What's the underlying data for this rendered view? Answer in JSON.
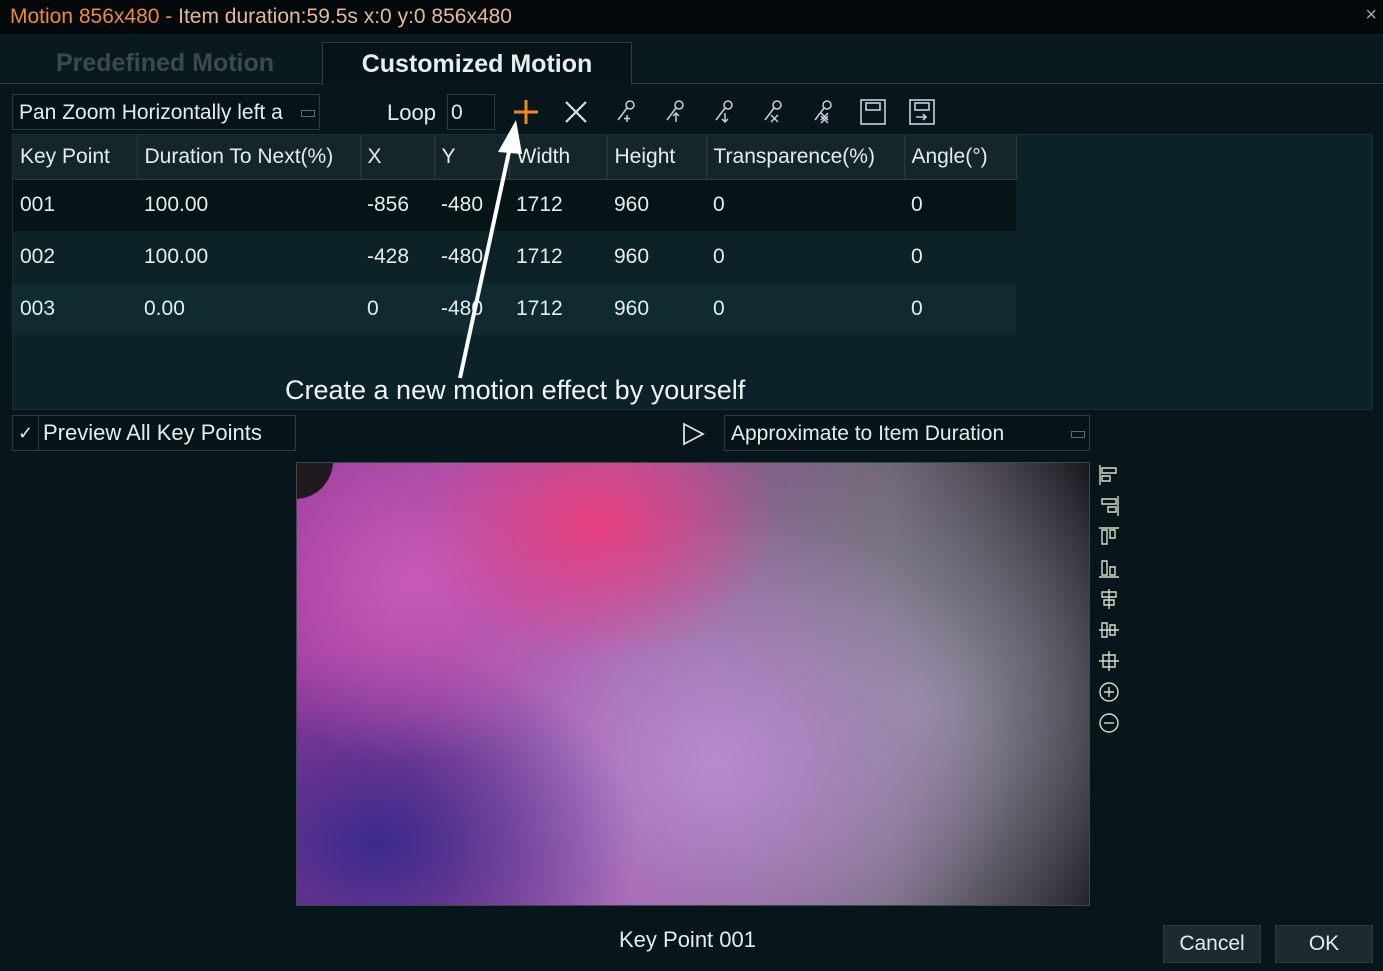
{
  "window": {
    "title_prefix": "Motion 856x480 - ",
    "title_rest": "Item duration:59.5s x:0 y:0 856x480",
    "close": "×"
  },
  "tabs": [
    {
      "label": "Predefined Motion",
      "active": false
    },
    {
      "label": "Customized Motion",
      "active": true
    }
  ],
  "toolbar": {
    "preset_value": "Pan Zoom Horizontally left a",
    "loop_label": "Loop",
    "loop_value": "0",
    "icons": [
      "add-icon",
      "delete-icon",
      "add-keypoint-icon",
      "move-keypoint-up-icon",
      "move-keypoint-down-icon",
      "delete-keypoint-icon",
      "delete-all-keypoints-icon",
      "save-icon",
      "export-icon"
    ],
    "accent": "#f08a1e"
  },
  "table": {
    "columns": [
      "Key Point",
      "Duration To Next(%)",
      "X",
      "Y",
      "Width",
      "Height",
      "Transparence(%)",
      "Angle(°)"
    ],
    "rows": [
      [
        "001",
        "100.00",
        "-856",
        "-480",
        "1712",
        "960",
        "0",
        "0"
      ],
      [
        "002",
        "100.00",
        "-428",
        "-480",
        "1712",
        "960",
        "0",
        "0"
      ],
      [
        "003",
        "0.00",
        "0",
        "-480",
        "1712",
        "960",
        "0",
        "0"
      ]
    ]
  },
  "annotation": "Create a new motion effect by yourself",
  "preview": {
    "checkbox_label": "Preview All Key Points",
    "checked": true,
    "duration_mode": "Approximate to Item Duration",
    "keypoint_label": "Key Point 001",
    "side_icons": [
      "align-left-icon",
      "align-right-icon",
      "align-top-icon",
      "align-bottom-icon",
      "center-vertical-icon",
      "center-horizontal-icon",
      "center-both-icon",
      "zoom-in-icon",
      "zoom-out-icon"
    ]
  },
  "buttons": {
    "cancel": "Cancel",
    "ok": "OK"
  }
}
